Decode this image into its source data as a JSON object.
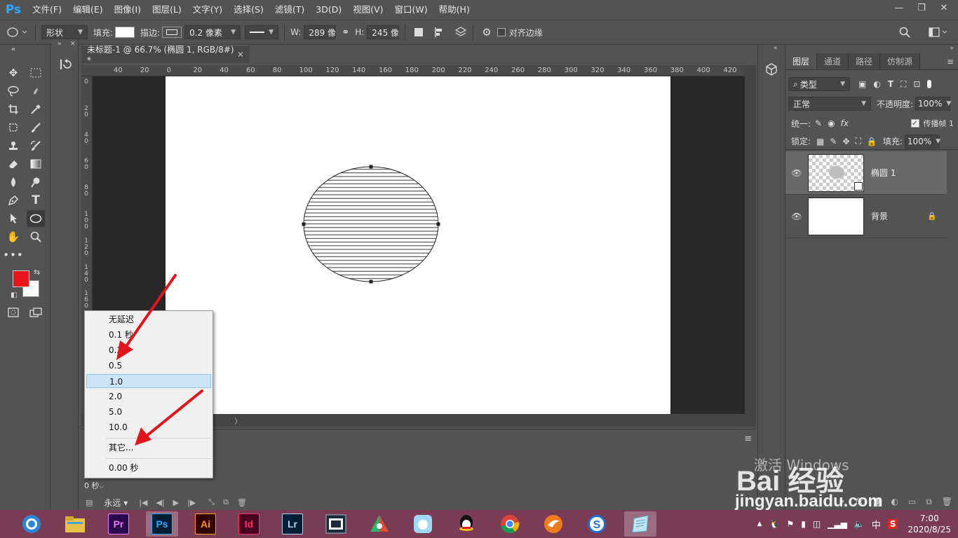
{
  "app": {
    "logo": "Ps"
  },
  "menu": [
    "文件(F)",
    "编辑(E)",
    "图像(I)",
    "图层(L)",
    "文字(Y)",
    "选择(S)",
    "滤镜(T)",
    "3D(D)",
    "视图(V)",
    "窗口(W)",
    "帮助(H)"
  ],
  "window_controls": {
    "minimize": "—",
    "restore": "❐",
    "close": "✕"
  },
  "options": {
    "tool_mode": "形状",
    "fill_label": "填充:",
    "stroke_label": "描边:",
    "stroke_width": "0.2 像素",
    "width_label": "W:",
    "width_value": "289 像素",
    "height_label": "H:",
    "height_value": "245 像素",
    "align_edges_label": "对齐边缘"
  },
  "document": {
    "tab_title": "未标题-1 @ 66.7% (椭圆 1, RGB/8#) *",
    "close_glyph": "✕",
    "ruler_top_ticks": [
      "40",
      "20",
      "0",
      "20",
      "40",
      "60",
      "80",
      "100",
      "120",
      "140",
      "160",
      "180",
      "200",
      "220",
      "240",
      "260",
      "280",
      "300",
      "320",
      "340",
      "360",
      "380",
      "400",
      "420"
    ],
    "ruler_left_ticks": [
      "0",
      "2 0",
      "4 0",
      "6 0",
      "8 0",
      "1 0 0",
      "1 2 0",
      "1 4 0",
      "1 6 0"
    ]
  },
  "timeline": {
    "frame_delay": "0 秒",
    "loop_option": "永远",
    "menu_glyph": "≡"
  },
  "delay_popup": {
    "items": [
      "无延迟",
      "0.1 秒",
      "0.2",
      "0.5",
      "1.0",
      "2.0",
      "5.0",
      "10.0"
    ],
    "selected": "1.0",
    "other": "其它...",
    "current": "0.00 秒"
  },
  "layers_panel": {
    "tabs": [
      "图层",
      "通道",
      "路径",
      "仿制源"
    ],
    "active_tab": "图层",
    "filter_kind": "类型",
    "blend_mode": "正常",
    "opacity_label": "不透明度:",
    "opacity_value": "100%",
    "unify_label": "统一:",
    "propagate_label": "传播帧 1",
    "lock_label": "锁定:",
    "fill_label": "填充:",
    "fill_value": "100%",
    "layers": [
      {
        "name": "椭圆 1",
        "active": true,
        "locked": false
      },
      {
        "name": "背景",
        "active": false,
        "locked": true
      }
    ]
  },
  "watermark": {
    "activate_text": "激活 Windows",
    "brand": "Bai 经验",
    "url": "jingyan.baidu.com"
  },
  "taskbar": {
    "apps": [
      {
        "name": "qq-browser",
        "label": ""
      },
      {
        "name": "file-explorer",
        "label": ""
      },
      {
        "name": "premiere",
        "label": "Pr",
        "bg": "#2a0a4a",
        "fg": "#ea77ff"
      },
      {
        "name": "photoshop",
        "label": "Ps",
        "bg": "#001e36",
        "fg": "#31a8ff",
        "active": true
      },
      {
        "name": "illustrator",
        "label": "Ai",
        "bg": "#330000",
        "fg": "#ff9a00"
      },
      {
        "name": "indesign",
        "label": "Id",
        "bg": "#49021f",
        "fg": "#ff3366"
      },
      {
        "name": "lightroom",
        "label": "Lr",
        "bg": "#001e36",
        "fg": "#add5ec"
      },
      {
        "name": "video-editor",
        "label": ""
      },
      {
        "name": "gallery-app",
        "label": ""
      },
      {
        "name": "notes-app",
        "label": ""
      },
      {
        "name": "qq",
        "label": ""
      },
      {
        "name": "chrome",
        "label": ""
      },
      {
        "name": "foxmail",
        "label": ""
      },
      {
        "name": "sogou",
        "label": ""
      },
      {
        "name": "notepad",
        "label": ""
      }
    ],
    "tray_ime": "中",
    "time": "7:00",
    "date": "2020/8/25"
  },
  "colors": {
    "foreground": "#e8171f",
    "background": "#ffffff",
    "taskbar": "#7a3b55",
    "arrow": "#e0141b"
  }
}
